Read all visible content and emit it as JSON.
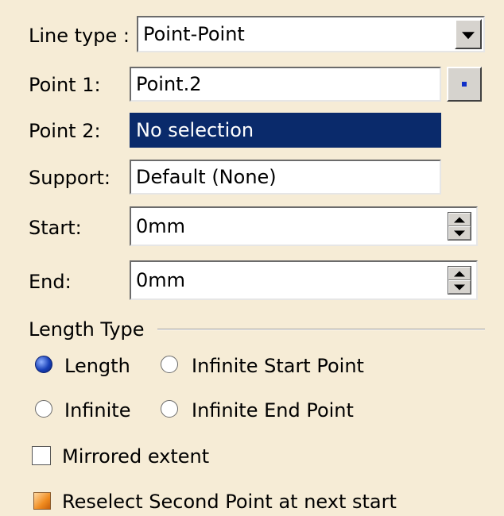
{
  "line_type": {
    "label": "Line type :",
    "value": "Point-Point"
  },
  "point1": {
    "label": "Point 1:",
    "value": "Point.2"
  },
  "point2": {
    "label": "Point 2:",
    "value": "No selection"
  },
  "support": {
    "label": "Support:",
    "value": "Default (None)"
  },
  "start": {
    "label": "Start:",
    "value": "0mm"
  },
  "end": {
    "label": "End:",
    "value": "0mm"
  },
  "length_type": {
    "title": "Length Type",
    "options": [
      "Length",
      "Infinite Start Point",
      "Infinite",
      "Infinite End Point"
    ],
    "selected": "Length"
  },
  "mirrored_extent": {
    "label": "Mirrored extent",
    "checked": false
  },
  "reselect": {
    "label": "Reselect Second Point at next start",
    "checked": true
  },
  "colors": {
    "background": "#f6ecd6",
    "selection": "#0a2a6b",
    "radio_selected": "#1840b8",
    "checkbox_checked": "#f08c20"
  }
}
